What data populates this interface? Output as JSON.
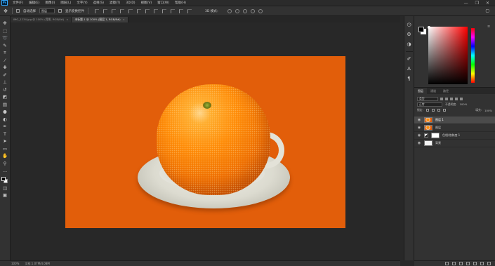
{
  "menubar": {
    "logo": "Ps",
    "items": [
      "文件(F)",
      "编辑(E)",
      "图像(I)",
      "图层(L)",
      "文字(Y)",
      "选择(S)",
      "滤镜(T)",
      "3D(D)",
      "视图(V)",
      "窗口(W)",
      "帮助(H)"
    ],
    "window_controls": [
      "—",
      "❐",
      "✕"
    ]
  },
  "options": {
    "auto_select_label": "自动选择",
    "auto_select_value": "图层",
    "transform_label": "显示变换控件",
    "mode3d_label": "3D 模式：",
    "right_icon": "▢"
  },
  "tabs": [
    {
      "label": "IMG_1234.jpg @ 100% (背景, RGB/8#)",
      "active": false
    },
    {
      "label": "未标题-1 @ 100% (图层 1, RGB/8#)",
      "active": true
    }
  ],
  "tools": [
    "move-icon",
    "marquee-icon",
    "lasso-icon",
    "quick-select-icon",
    "crop-icon",
    "eyedropper-icon",
    "healing-icon",
    "brush-icon",
    "stamp-icon",
    "history-brush-icon",
    "eraser-icon",
    "gradient-icon",
    "blur-icon",
    "dodge-icon",
    "pen-icon",
    "type-icon",
    "path-select-icon",
    "shape-icon",
    "hand-icon",
    "zoom-icon",
    "more-icon"
  ],
  "status": {
    "zoom": "100%",
    "doc_info": "文档:1.07M/4.08M"
  },
  "color_panel": {
    "menu": "≡",
    "foreground": "#000000",
    "background": "#ffffff"
  },
  "layers": {
    "tabs": [
      "图层",
      "通道",
      "路径"
    ],
    "kind": "类型",
    "blend": "正常",
    "opacity_label": "不透明度:",
    "opacity_value": "100%",
    "lock_label": "锁定:",
    "fill_label": "填充:",
    "fill_value": "100%",
    "items": [
      {
        "name": "图层 1",
        "selected": true
      },
      {
        "name": "图层",
        "selected": false
      },
      {
        "name": "色相/饱和度 1",
        "selected": false
      },
      {
        "name": "背景",
        "selected": false
      }
    ]
  },
  "colors": {
    "canvas_orange": "#e25e0a",
    "ui_dark": "#323232"
  }
}
